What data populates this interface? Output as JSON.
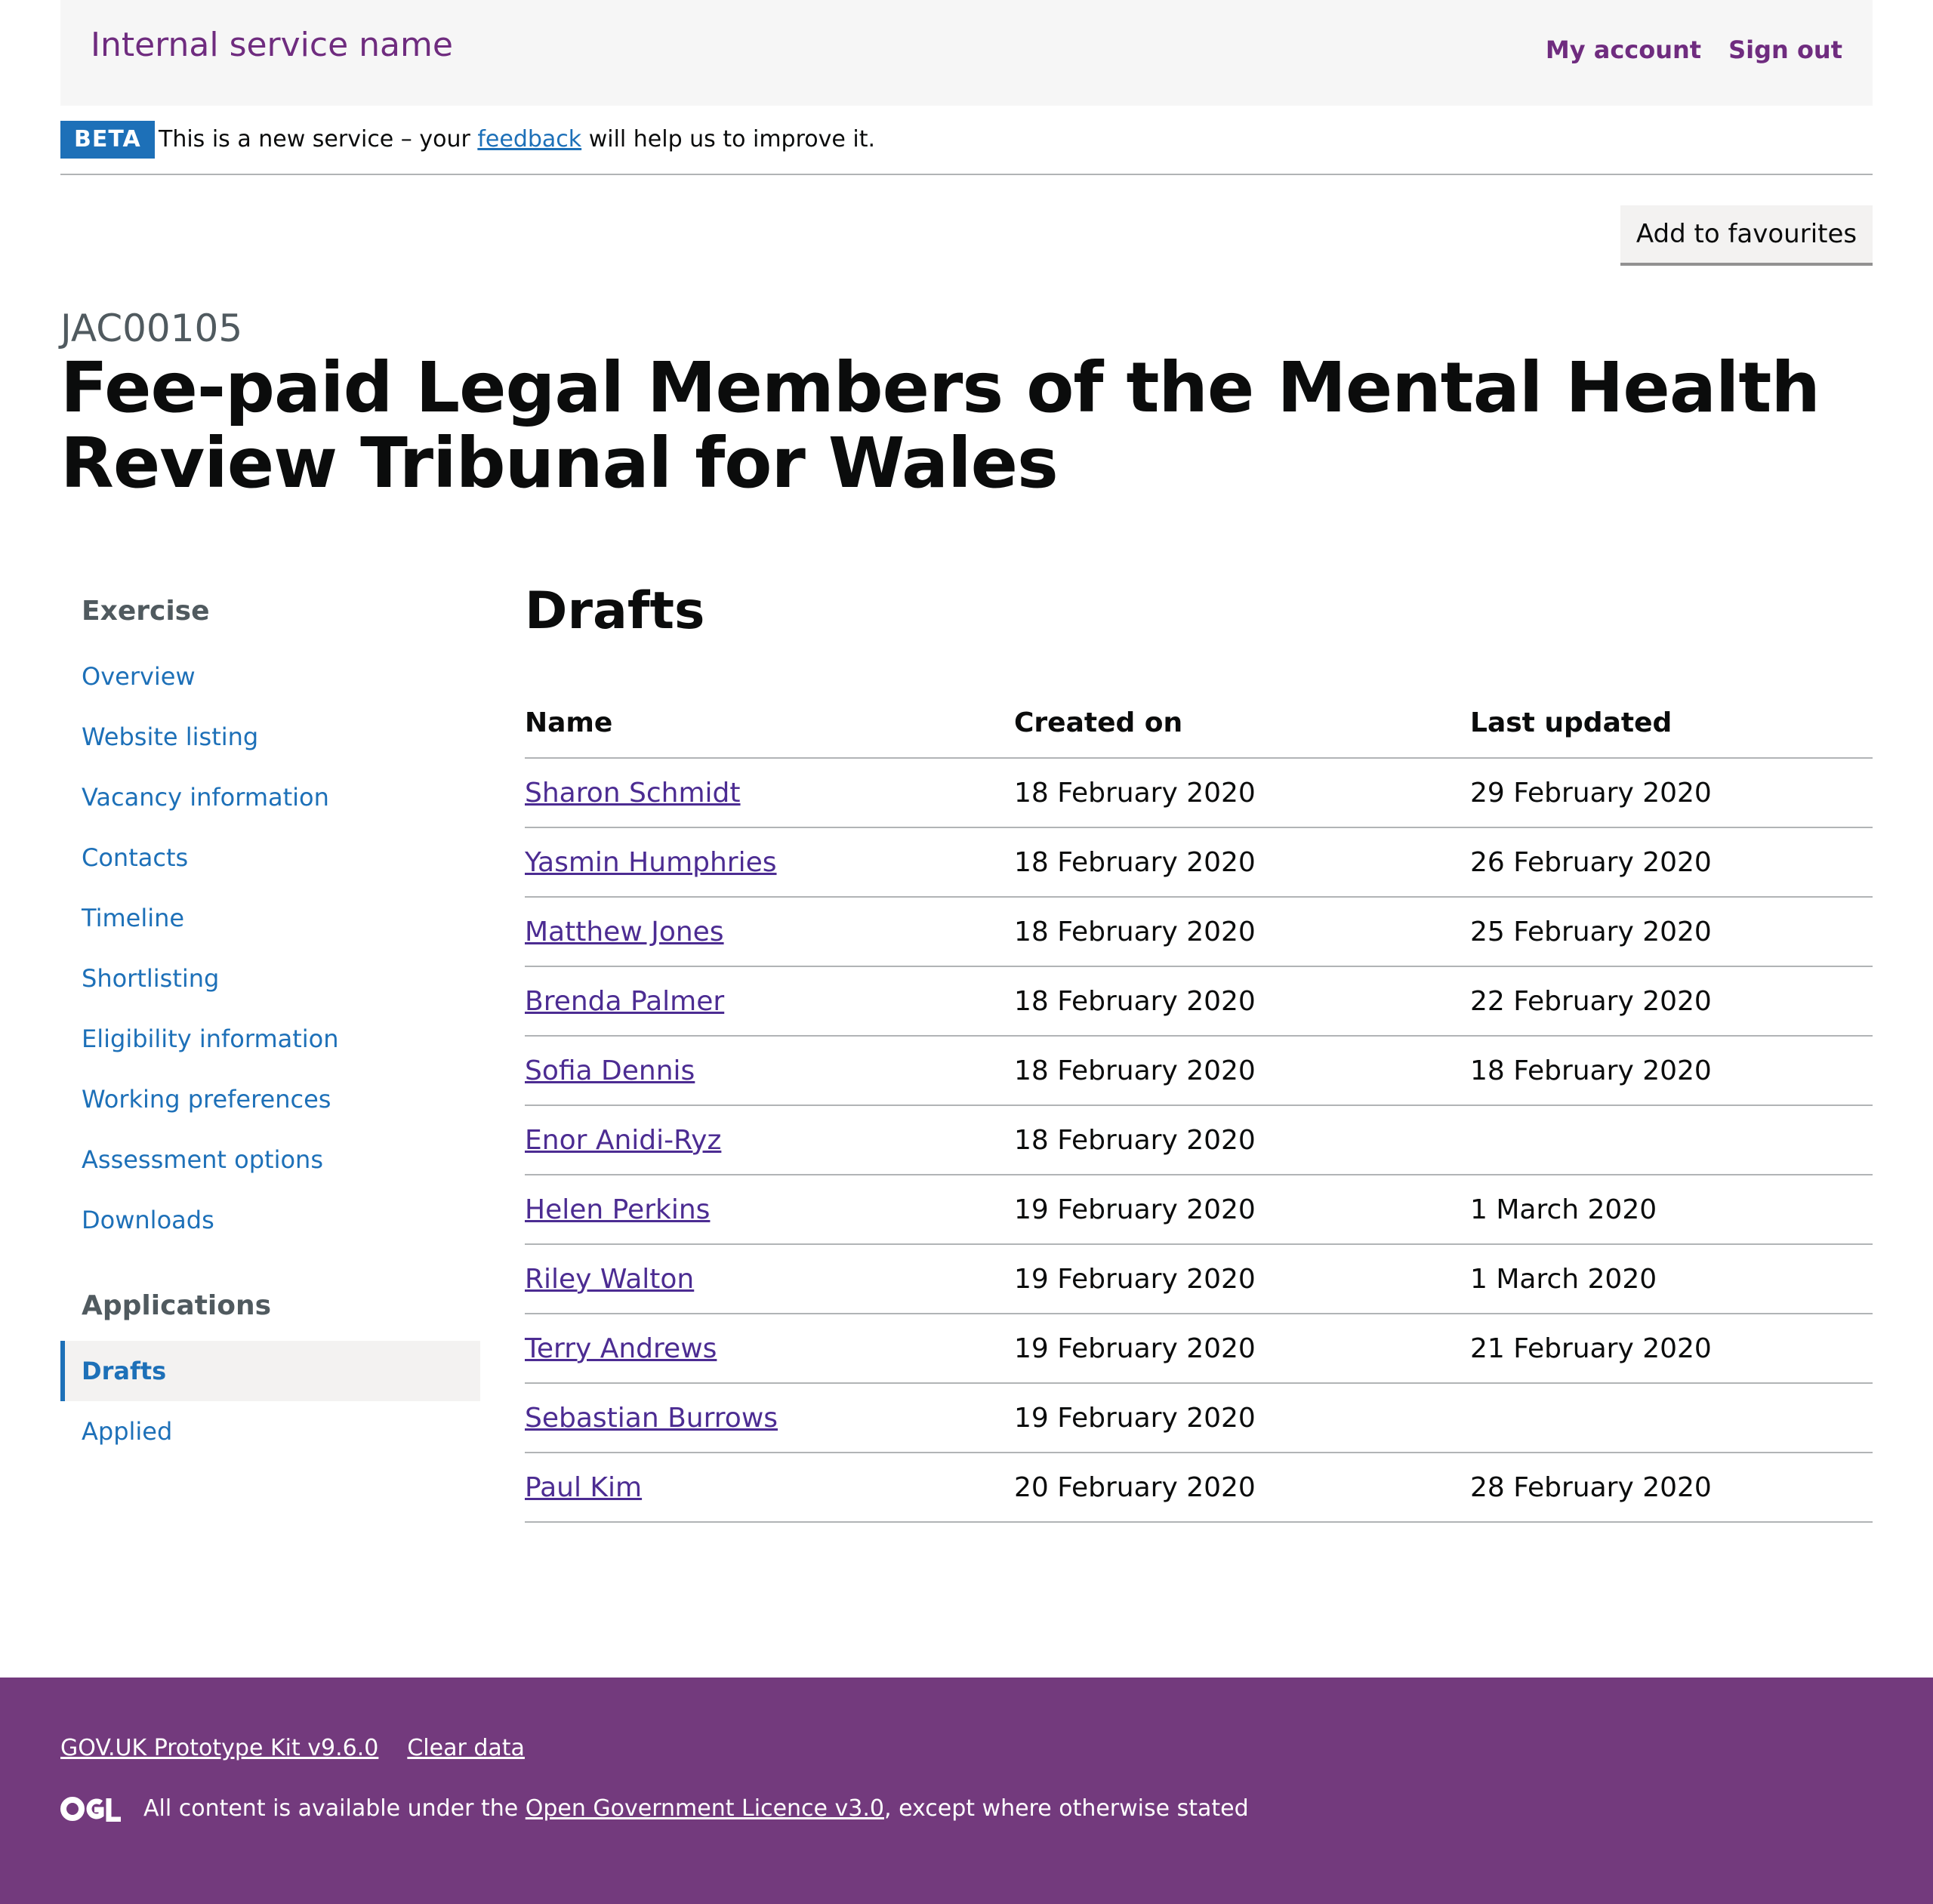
{
  "header": {
    "service_name": "Internal service name",
    "nav": [
      "My account",
      "Sign out"
    ]
  },
  "phase_banner": {
    "tag": "BETA",
    "text_before": "This is a new service – your ",
    "link": "feedback",
    "text_after": " will help us to improve it."
  },
  "favourites_button": "Add to favourites",
  "caption": "JAC00105",
  "title": "Fee-paid Legal Members of the Mental Health Review Tribunal for Wales",
  "sidebar": {
    "exercise_heading": "Exercise",
    "exercise_items": [
      "Overview",
      "Website listing",
      "Vacancy information",
      "Contacts",
      "Timeline",
      "Shortlisting",
      "Eligibility information",
      "Working preferences",
      "Assessment options",
      "Downloads"
    ],
    "applications_heading": "Applications",
    "applications_items": [
      "Drafts",
      "Applied"
    ],
    "active_item": "Drafts"
  },
  "main": {
    "heading": "Drafts",
    "columns": [
      "Name",
      "Created on",
      "Last updated"
    ],
    "rows": [
      [
        "Sharon Schmidt",
        "18 February 2020",
        "29 February 2020"
      ],
      [
        "Yasmin Humphries",
        "18 February 2020",
        "26 February 2020"
      ],
      [
        "Matthew Jones",
        "18 February 2020",
        "25 February 2020"
      ],
      [
        "Brenda Palmer",
        "18 February 2020",
        "22 February 2020"
      ],
      [
        "Sofia Dennis",
        "18 February 2020",
        "18 February 2020"
      ],
      [
        "Enor Anidi-Ryz",
        "18 February 2020",
        ""
      ],
      [
        "Helen Perkins",
        "19 February 2020",
        "1 March 2020"
      ],
      [
        "Riley Walton",
        "19 February 2020",
        "1 March 2020"
      ],
      [
        "Terry Andrews",
        "19 February 2020",
        "21 February 2020"
      ],
      [
        "Sebastian Burrows",
        "19 February 2020",
        ""
      ],
      [
        "Paul Kim",
        "20 February 2020",
        "28 February 2020"
      ]
    ]
  },
  "footer": {
    "links": [
      "GOV.UK Prototype Kit v9.6.0",
      "Clear data"
    ],
    "licence_before": "All content is available under the ",
    "licence_link": "Open Government Licence v3.0",
    "licence_after": ", except where otherwise stated",
    "logo_icon": "ogl-logo-icon"
  },
  "colors": {
    "brand_purple": "#6f2c7f",
    "footer_purple": "#733a7d",
    "link_blue": "#1d70b8",
    "visited_link": "#4c2c92"
  }
}
